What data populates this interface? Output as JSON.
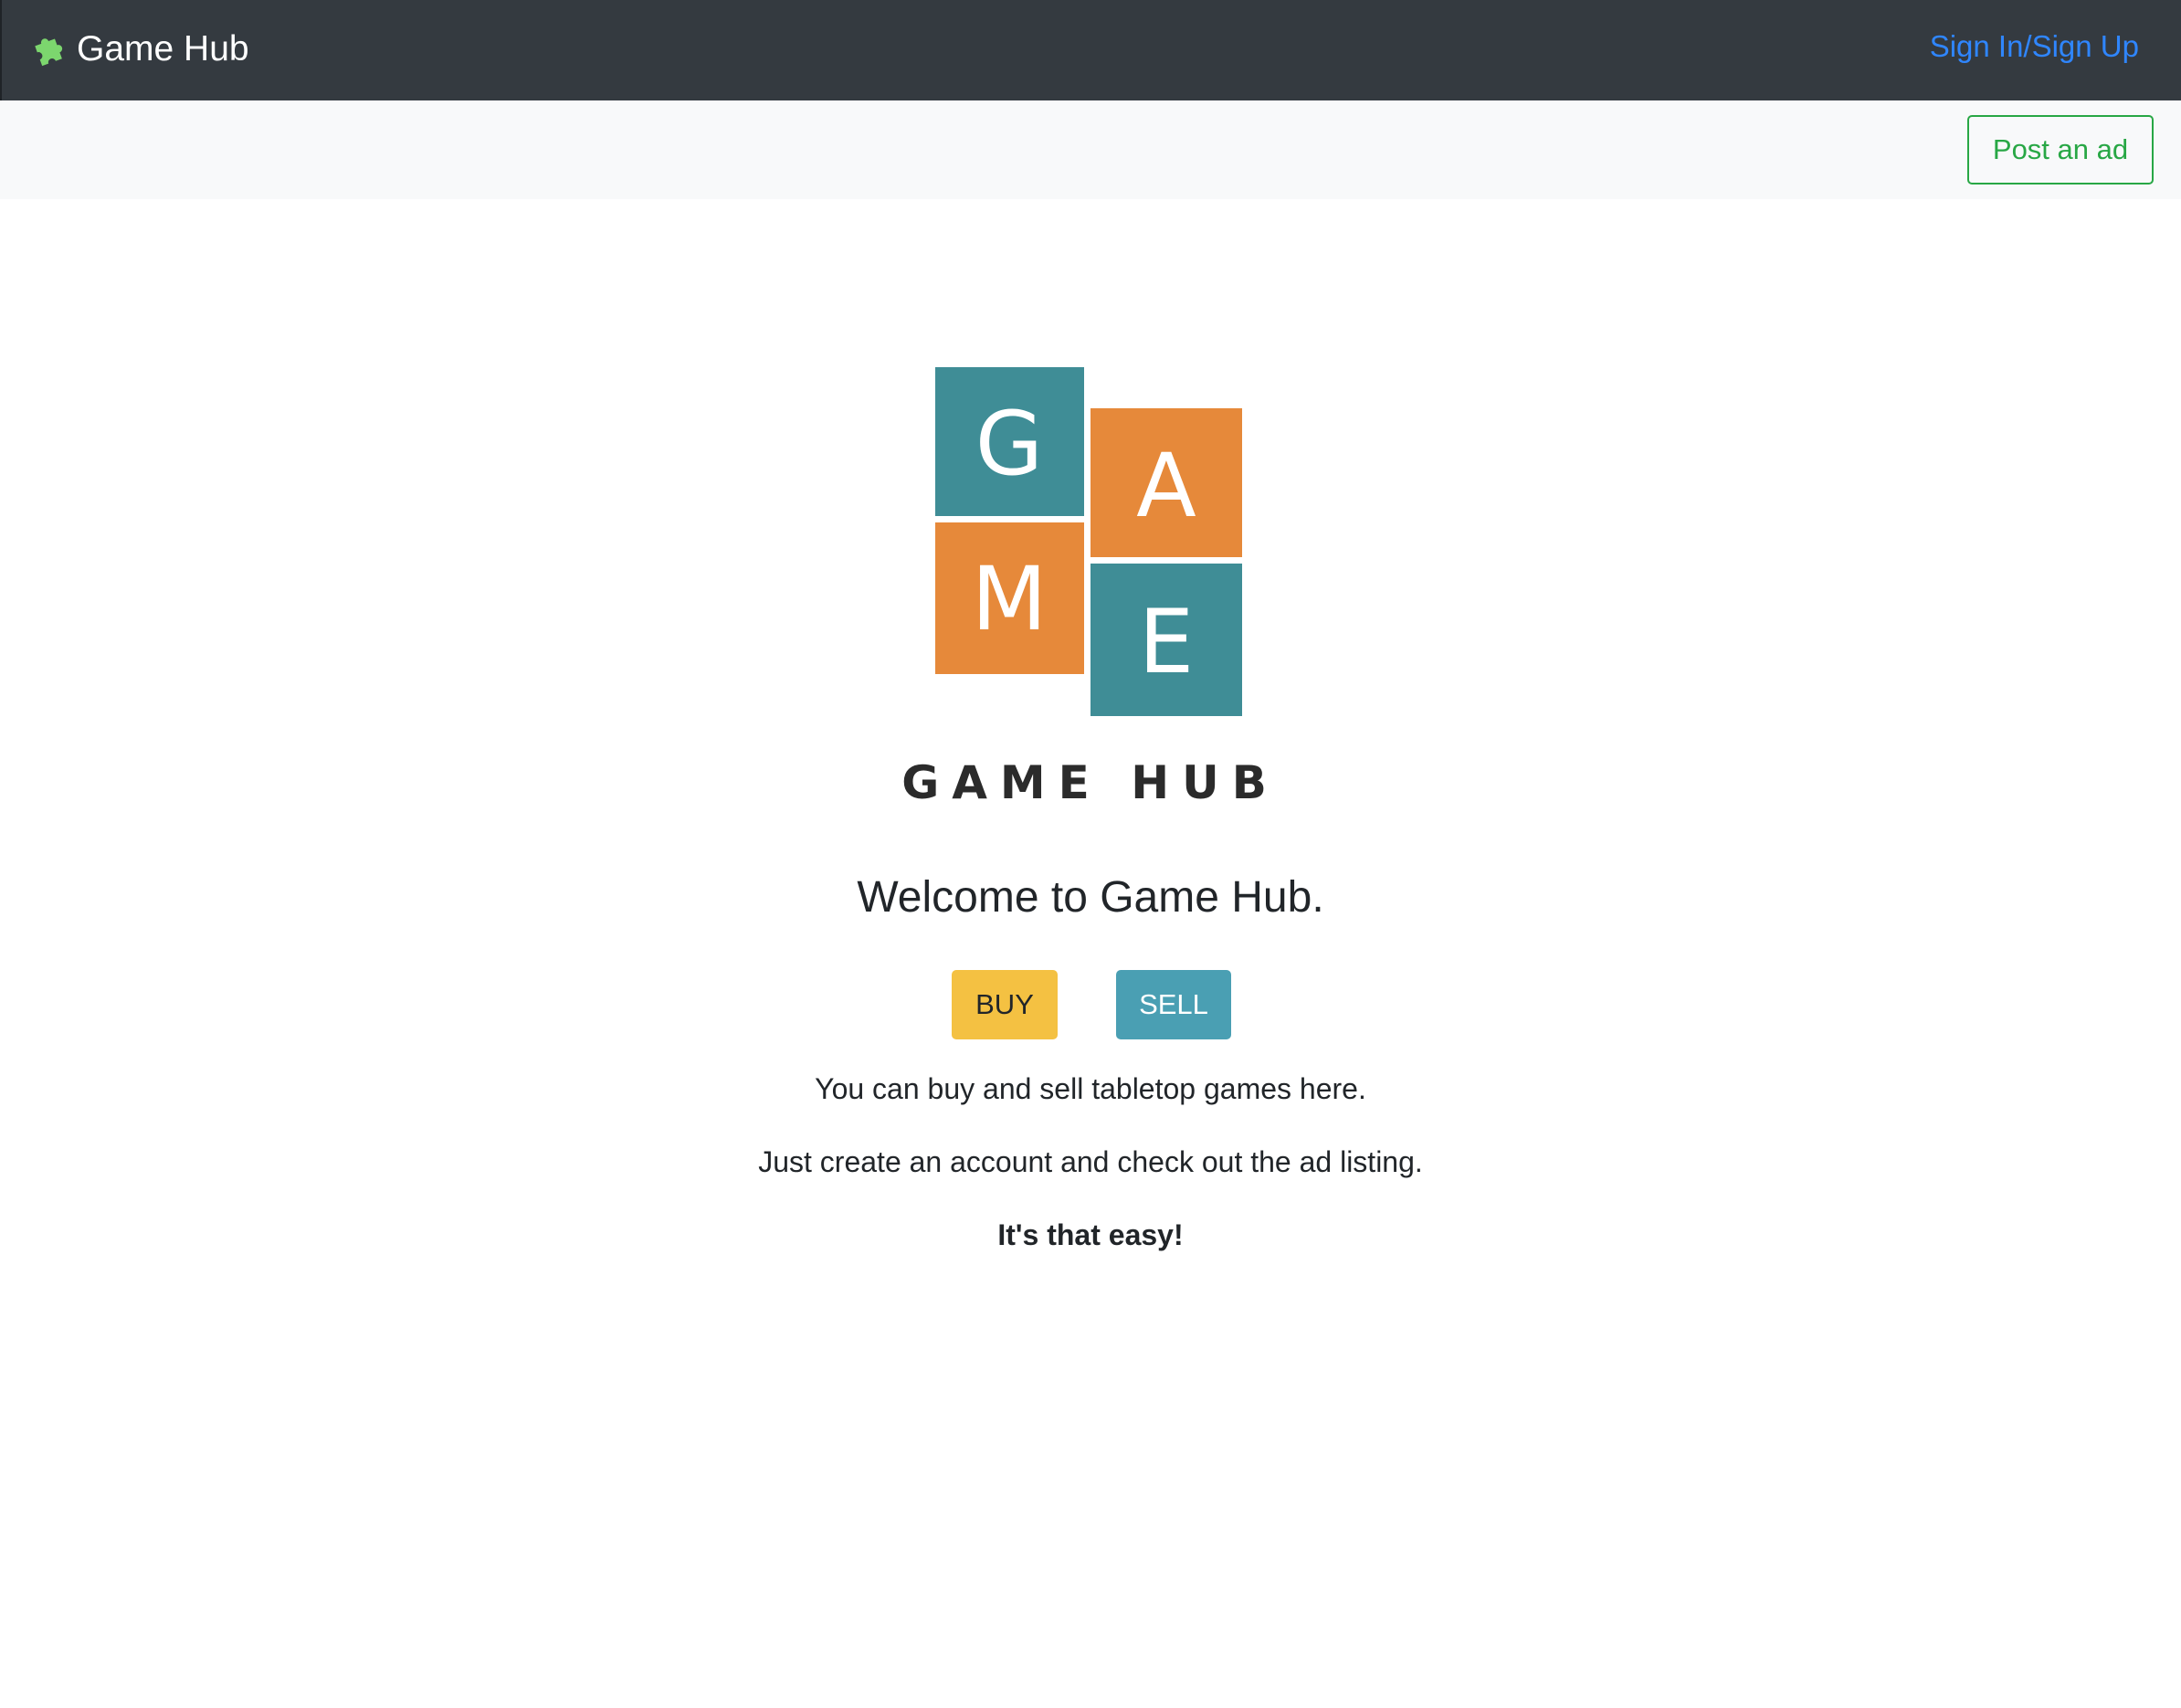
{
  "navbar": {
    "brand": "Game Hub",
    "brand_icon": "puzzle-piece-icon",
    "brand_icon_color": "#7cd66e",
    "signin_label": "Sign In/Sign Up",
    "link_color": "#2f86ff",
    "background": "#343a40"
  },
  "subbar": {
    "post_ad_label": "Post an ad",
    "accent": "#28a745"
  },
  "logo": {
    "tiles": [
      "G",
      "A",
      "M",
      "E"
    ],
    "wordmark": "GAME HUB",
    "teal": "#3f8d96",
    "orange": "#e6893a"
  },
  "main": {
    "heading": "Welcome to Game Hub.",
    "buy_label": "BUY",
    "sell_label": "SELL",
    "buy_color": "#f4c142",
    "sell_color": "#4a9fb3",
    "line1": "You can buy and sell tabletop games here.",
    "line2": "Just create an account and check out the ad listing.",
    "line3": "It's that easy!"
  }
}
